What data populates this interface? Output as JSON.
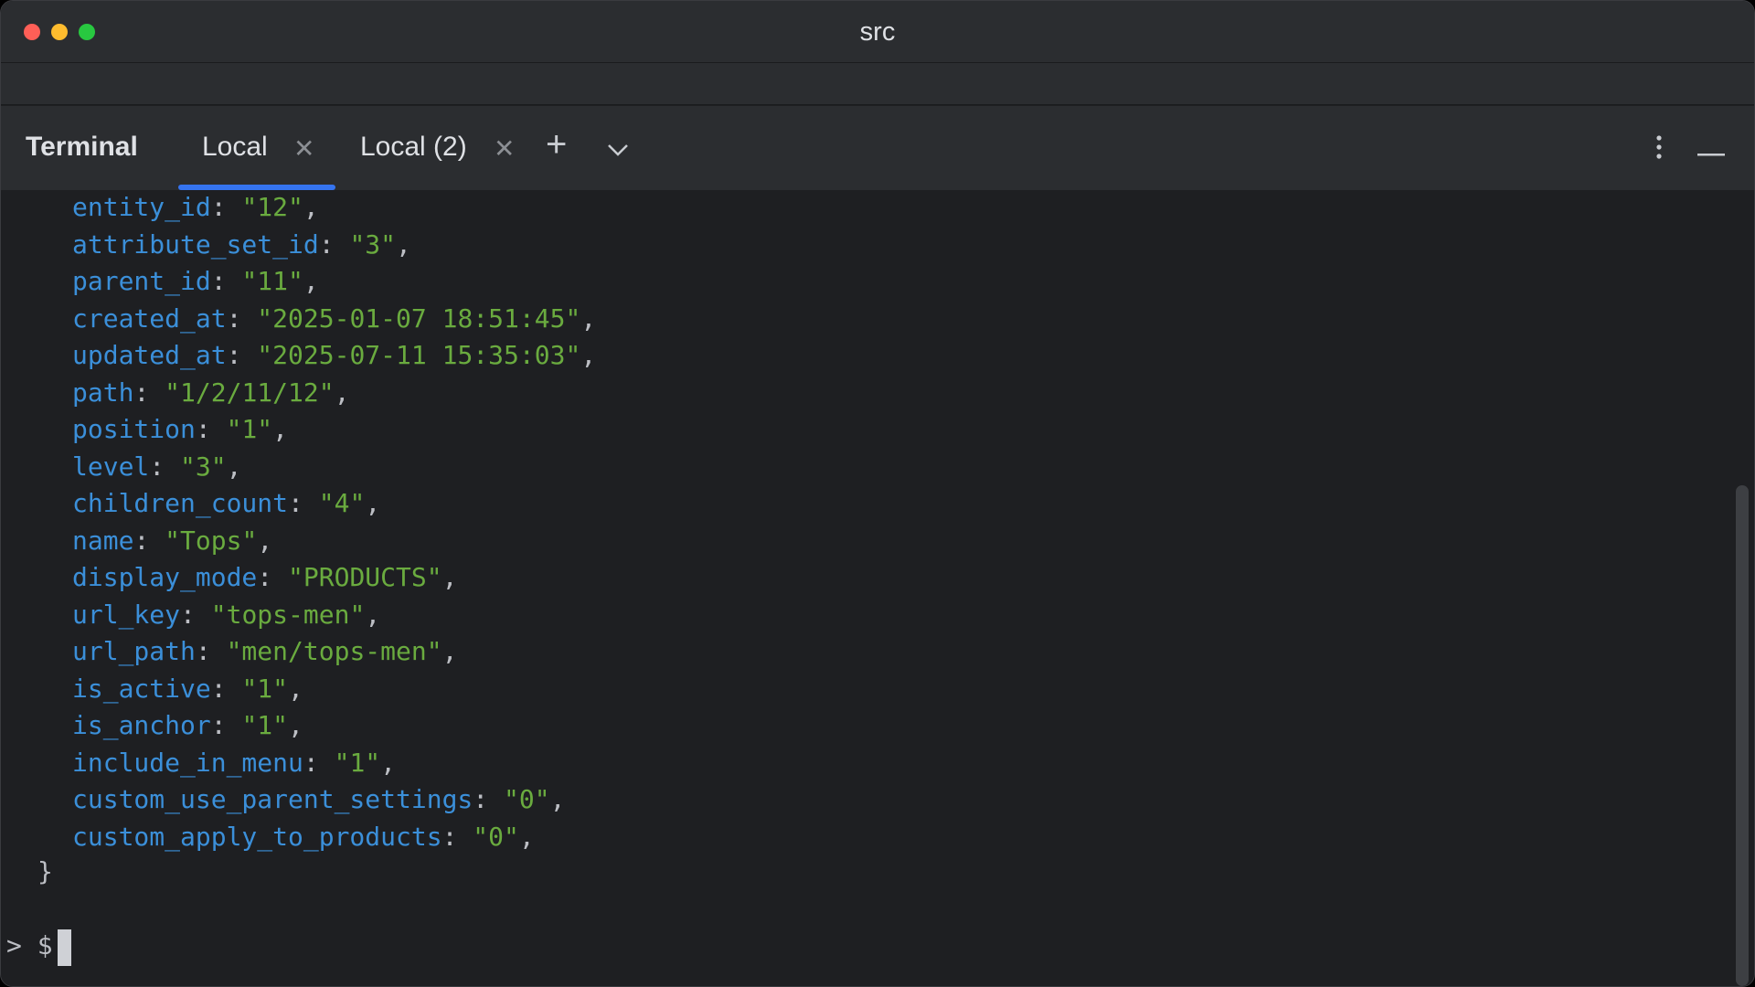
{
  "window": {
    "title": "src"
  },
  "panel": {
    "tool_title": "Terminal",
    "tabs": [
      {
        "label": "Local",
        "active": true
      },
      {
        "label": "Local (2)",
        "active": false
      }
    ]
  },
  "icons": {
    "close_tab": "close-icon",
    "new_tab": "plus-icon",
    "tab_options": "chevron-down-icon",
    "more": "more-vertical-icon",
    "hide": "minimize-icon"
  },
  "colors": {
    "key": "#3b8fd9",
    "string": "#6aab3f",
    "accent": "#3574f0",
    "background": "#1e1f22"
  },
  "output": {
    "lines": [
      {
        "key": "entity_id",
        "value": "\"12\""
      },
      {
        "key": "attribute_set_id",
        "value": "\"3\""
      },
      {
        "key": "parent_id",
        "value": "\"11\""
      },
      {
        "key": "created_at",
        "value": "\"2025-01-07 18:51:45\""
      },
      {
        "key": "updated_at",
        "value": "\"2025-07-11 15:35:03\""
      },
      {
        "key": "path",
        "value": "\"1/2/11/12\""
      },
      {
        "key": "position",
        "value": "\"1\""
      },
      {
        "key": "level",
        "value": "\"3\""
      },
      {
        "key": "children_count",
        "value": "\"4\""
      },
      {
        "key": "name",
        "value": "\"Tops\""
      },
      {
        "key": "display_mode",
        "value": "\"PRODUCTS\""
      },
      {
        "key": "url_key",
        "value": "\"tops-men\""
      },
      {
        "key": "url_path",
        "value": "\"men/tops-men\""
      },
      {
        "key": "is_active",
        "value": "\"1\""
      },
      {
        "key": "is_anchor",
        "value": "\"1\""
      },
      {
        "key": "include_in_menu",
        "value": "\"1\""
      },
      {
        "key": "custom_use_parent_settings",
        "value": "\"0\""
      },
      {
        "key": "custom_apply_to_products",
        "value": "\"0\""
      }
    ],
    "closing_brace": "}"
  },
  "prompt": {
    "text": "> $"
  }
}
